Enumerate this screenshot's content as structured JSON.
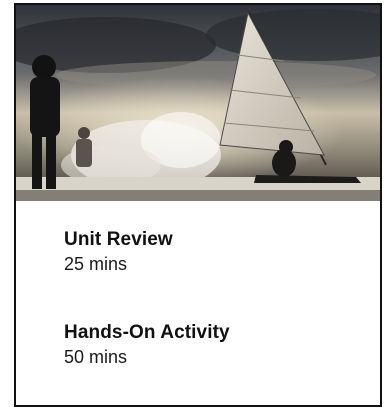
{
  "hero_image": {
    "semantic": "photo-iceboat-sailing-splash-silhouettes"
  },
  "items": [
    {
      "title": "Unit Review",
      "duration": "25 mins"
    },
    {
      "title": "Hands-On Activity",
      "duration": "50 mins"
    }
  ],
  "colors": {
    "border": "#111111",
    "text": "#111111",
    "background": "#ffffff"
  }
}
